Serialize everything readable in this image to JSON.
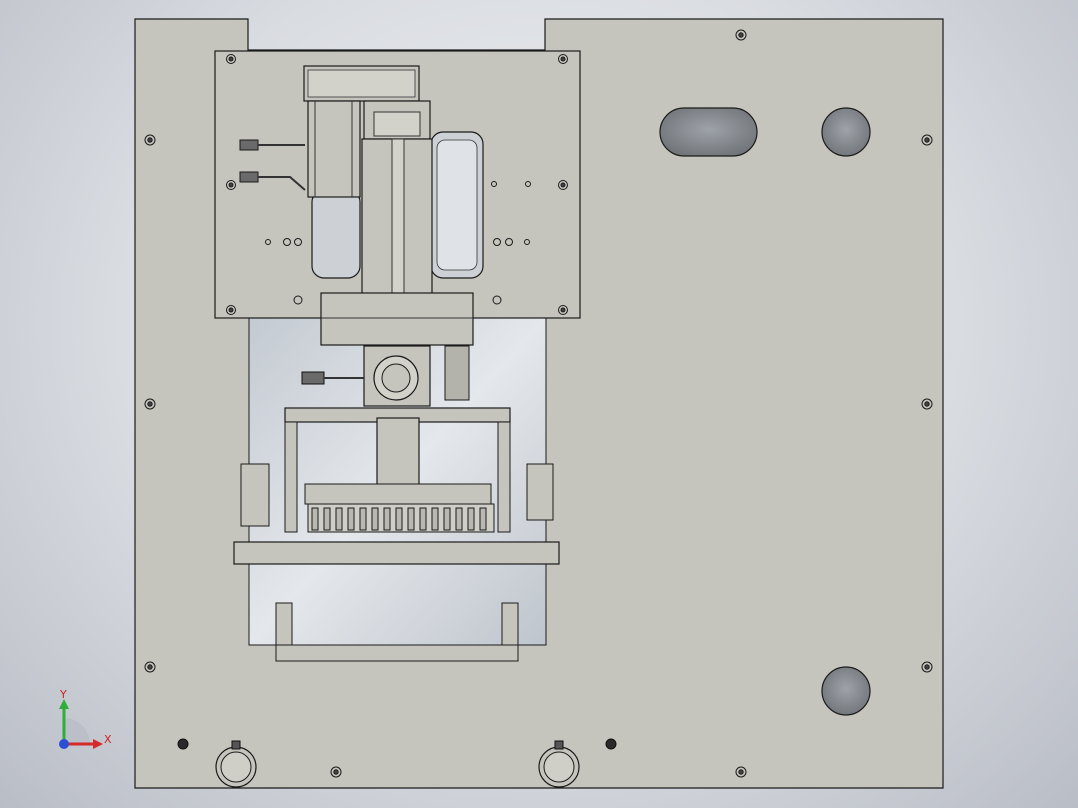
{
  "viewport": {
    "background_top": "#f2f3f5",
    "background_bottom": "#b9bdc6",
    "part_fill": "#c6c5bd",
    "part_fill_light": "#d2d1ca",
    "cavity_fill": "#cfd3d9",
    "edge_color": "#1a1a1a",
    "hole_fill": "#8a8f95"
  },
  "triad": {
    "x_label": "X",
    "y_label": "Y",
    "x_color": "#d42a2a",
    "y_color": "#2fae3a",
    "z_color": "#2a4fd4",
    "origin_icon": "coordinate-triad-icon"
  }
}
